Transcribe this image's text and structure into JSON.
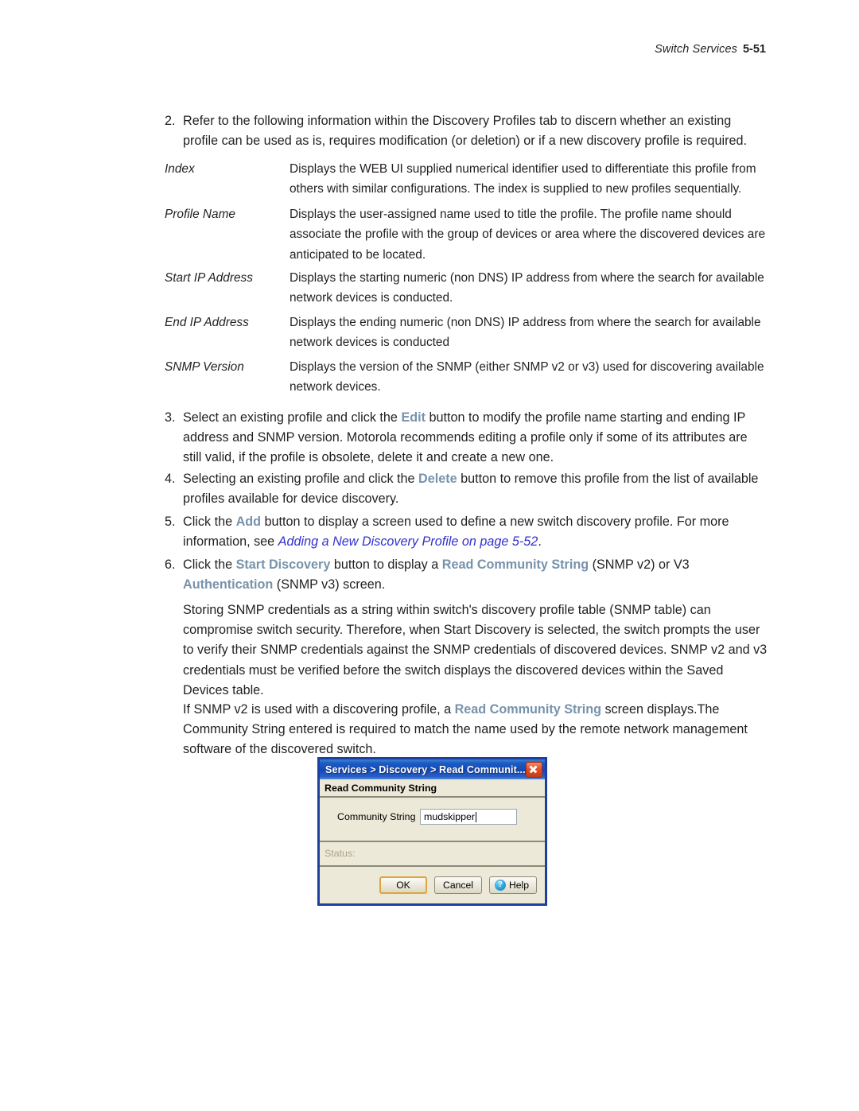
{
  "header": {
    "title": "Switch Services",
    "folio": "5-51"
  },
  "steps": {
    "step2": {
      "number": "2.",
      "text": "Refer to the following information within the Discovery Profiles tab to discern whether an existing profile can be used as is, requires modification (or deletion) or if a new discovery profile is required."
    },
    "step3": {
      "number": "3.",
      "part1": "Select an existing profile and click the ",
      "keyword": "Edit",
      "part2": " button to modify the profile name starting and ending IP address and SNMP version. Motorola recommends editing a profile only if some of its attributes are still valid, if the profile is obsolete, delete it and create a new one."
    },
    "step4": {
      "number": "4.",
      "part1": "Selecting an existing profile and click the ",
      "keyword": "Delete",
      "part2": " button to remove this profile from the list of available profiles available for device discovery."
    },
    "step5": {
      "number": "5.",
      "part1": "Click the ",
      "keyword": "Add",
      "part2": " button to display a screen used to define a new switch discovery profile. For more information, see ",
      "xref": "Adding a New Discovery Profile on page 5-52",
      "part3": "."
    },
    "step6": {
      "number": "6.",
      "part1": "Click the ",
      "keyword1": "Start Discovery",
      "part2": " button to display a ",
      "keyword2": "Read Community String",
      "part3": " (SNMP v2) or V3 ",
      "keyword3": "Authentication",
      "part4": " (SNMP v3) screen."
    }
  },
  "definitions": [
    {
      "term": "Index",
      "description": "Displays the WEB UI supplied numerical identifier used to differentiate this profile from others with similar configurations. The index is supplied to new profiles sequentially."
    },
    {
      "term": "Profile Name",
      "description": "Displays the user-assigned name used to title the profile. The profile name should associate the profile with the group of devices or area where the discovered devices are anticipated to be located."
    },
    {
      "term": "Start IP Address",
      "description": "Displays the starting numeric (non DNS) IP address from where the search for available network devices is conducted."
    },
    {
      "term": "End IP Address",
      "description": "Displays the ending numeric (non DNS) IP address from where the search for available network devices is conducted"
    },
    {
      "term": "SNMP Version",
      "description": "Displays the version of the SNMP (either SNMP v2 or v3) used for discovering available network devices."
    }
  ],
  "paragraphs": {
    "security_note": "Storing SNMP credentials as a string within switch's discovery profile table (SNMP table) can compromise switch security. Therefore, when Start Discovery is selected, the switch prompts the user to verify their SNMP credentials against the SNMP credentials of discovered devices. SNMP v2 and v3 credentials must be verified before the switch displays the discovered devices within the Saved Devices table.",
    "snmpv2_note": {
      "part1": "If SNMP v2 is used with a discovering profile, a ",
      "keyword": "Read Community String",
      "part2": " screen displays.The Community String entered is required to match the name used by the remote network management software of the discovered switch."
    }
  },
  "dialog": {
    "titlebar": "Services > Discovery > Read Communit...",
    "close_icon": "close-icon",
    "section_title": "Read Community String",
    "field_label": "Community String",
    "field_value": "mudskipper",
    "status_label": "Status:",
    "buttons": {
      "ok": "OK",
      "cancel": "Cancel",
      "help": "Help",
      "help_icon": "?"
    }
  },
  "colors": {
    "keyword_blue": "#7792ab",
    "xref_blue": "#3232cd",
    "titlebar_blue": "#1548b4",
    "close_red": "#c23a16"
  }
}
